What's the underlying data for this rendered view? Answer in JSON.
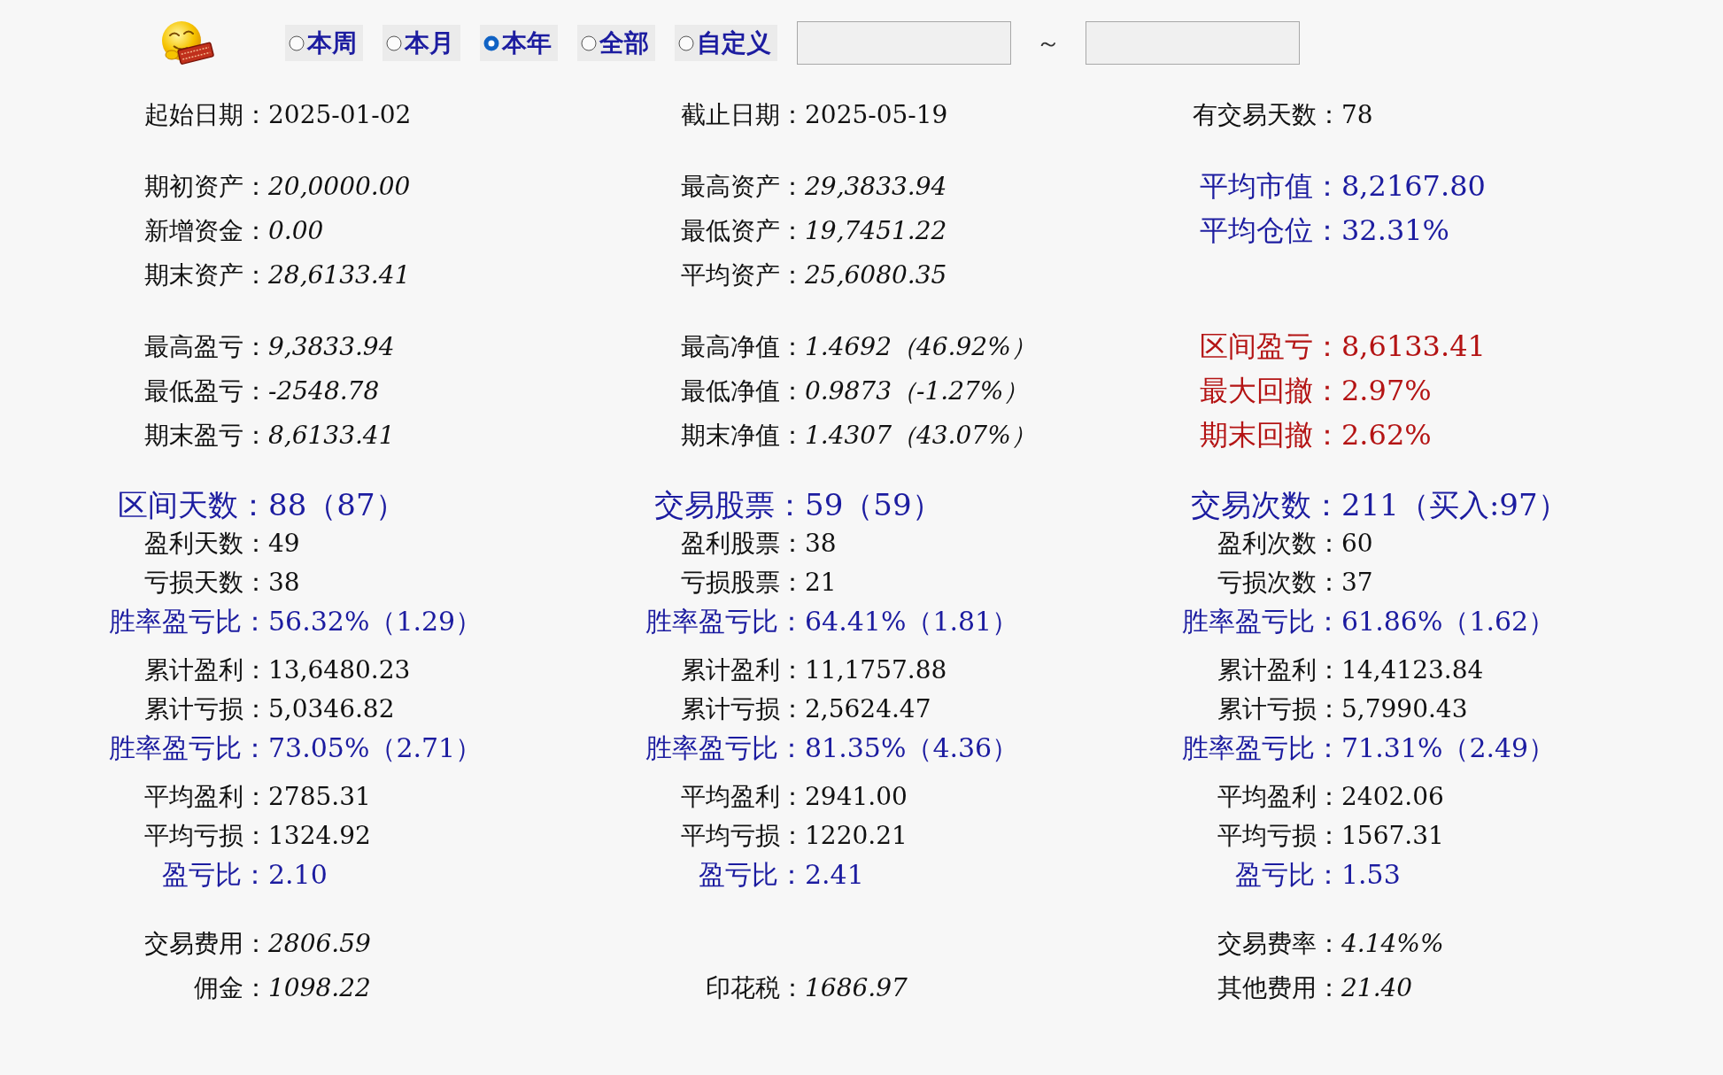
{
  "toolbar": {
    "period_options": [
      {
        "label": "本周",
        "selected": false
      },
      {
        "label": "本月",
        "selected": false
      },
      {
        "label": "本年",
        "selected": true
      },
      {
        "label": "全部",
        "selected": false
      },
      {
        "label": "自定义",
        "selected": false
      }
    ],
    "range_separator": "～"
  },
  "sections": [
    {
      "kind": "regular",
      "groups": [
        {
          "rows": [
            {
              "left": {
                "kind": "plain",
                "label": "起始日期：",
                "value": "2025-01-02"
              },
              "middle": {
                "kind": "plain",
                "label": "截止日期：",
                "value": "2025-05-19"
              },
              "right": {
                "kind": "plain",
                "label": "有交易天数：",
                "value": "78"
              }
            }
          ]
        }
      ]
    },
    {
      "kind": "regular",
      "groups": [
        {
          "rows": [
            {
              "left": {
                "kind": "italic",
                "label": "期初资产：",
                "value": "20,0000.00"
              },
              "middle": {
                "kind": "italic",
                "label": "最高资产：",
                "value": "29,3833.94"
              },
              "right": {
                "kind": "highlight",
                "label": "平均市值：",
                "value": "8,2167.80"
              }
            },
            {
              "left": {
                "kind": "italic",
                "label": "新增资金：",
                "value": "0.00"
              },
              "middle": {
                "kind": "italic",
                "label": "最低资产：",
                "value": "19,7451.22"
              },
              "right": {
                "kind": "highlight",
                "label": "平均仓位：",
                "value": "32.31%"
              }
            },
            {
              "left": {
                "kind": "italic",
                "label": "期末资产：",
                "value": "28,6133.41"
              },
              "middle": {
                "kind": "italic",
                "label": "平均资产：",
                "value": "25,6080.35"
              }
            }
          ]
        }
      ]
    },
    {
      "kind": "regular",
      "groups": [
        {
          "rows": [
            {
              "left": {
                "kind": "italic",
                "label": "最高盈亏：",
                "value": "9,3833.94"
              },
              "middle": {
                "kind": "italic",
                "label": "最高净值：",
                "value": "1.4692（46.92%）"
              },
              "right": {
                "kind": "alert",
                "label": "区间盈亏：",
                "value": "8,6133.41"
              }
            },
            {
              "left": {
                "kind": "italic",
                "label": "最低盈亏：",
                "value": "-2548.78"
              },
              "middle": {
                "kind": "italic",
                "label": "最低净值：",
                "value": "0.9873（-1.27%）"
              },
              "right": {
                "kind": "alert",
                "label": "最大回撤：",
                "value": "2.97%"
              }
            },
            {
              "left": {
                "kind": "italic",
                "label": "期末盈亏：",
                "value": "8,6133.41"
              },
              "middle": {
                "kind": "italic",
                "label": "期末净值：",
                "value": "1.4307（43.07%）"
              },
              "right": {
                "kind": "alert",
                "label": "期末回撤：",
                "value": "2.62%"
              }
            }
          ]
        }
      ]
    },
    {
      "kind": "compact",
      "groups": [
        {
          "rows": [
            {
              "left": {
                "kind": "heading",
                "label": "区间天数：",
                "value": "88（87）"
              },
              "middle": {
                "kind": "heading",
                "label": "交易股票：",
                "value": "59（59）"
              },
              "right": {
                "kind": "heading",
                "label": "交易次数：",
                "value": "211（买入:97）"
              }
            },
            {
              "left": {
                "kind": "plain",
                "label": "盈利天数：",
                "value": "49"
              },
              "middle": {
                "kind": "plain",
                "label": "盈利股票：",
                "value": "38"
              },
              "right": {
                "kind": "plain",
                "label": "盈利次数：",
                "value": "60"
              }
            },
            {
              "left": {
                "kind": "plain",
                "label": "亏损天数：",
                "value": "38"
              },
              "middle": {
                "kind": "plain",
                "label": "亏损股票：",
                "value": "21"
              },
              "right": {
                "kind": "plain",
                "label": "亏损次数：",
                "value": "37"
              }
            },
            {
              "left": {
                "kind": "ratio",
                "label": "胜率盈亏比：",
                "value": "56.32%（1.29）"
              },
              "middle": {
                "kind": "ratio",
                "label": "胜率盈亏比：",
                "value": "64.41%（1.81）"
              },
              "right": {
                "kind": "ratio",
                "label": "胜率盈亏比：",
                "value": "61.86%（1.62）"
              }
            }
          ]
        },
        {
          "rows": [
            {
              "left": {
                "kind": "plain",
                "label": "累计盈利：",
                "value": "13,6480.23"
              },
              "middle": {
                "kind": "plain",
                "label": "累计盈利：",
                "value": "11,1757.88"
              },
              "right": {
                "kind": "plain",
                "label": "累计盈利：",
                "value": "14,4123.84"
              }
            },
            {
              "left": {
                "kind": "plain",
                "label": "累计亏损：",
                "value": "5,0346.82"
              },
              "middle": {
                "kind": "plain",
                "label": "累计亏损：",
                "value": "2,5624.47"
              },
              "right": {
                "kind": "plain",
                "label": "累计亏损：",
                "value": "5,7990.43"
              }
            },
            {
              "left": {
                "kind": "ratio",
                "label": "胜率盈亏比：",
                "value": "73.05%（2.71）"
              },
              "middle": {
                "kind": "ratio",
                "label": "胜率盈亏比：",
                "value": "81.35%（4.36）"
              },
              "right": {
                "kind": "ratio",
                "label": "胜率盈亏比：",
                "value": "71.31%（2.49）"
              }
            }
          ]
        },
        {
          "rows": [
            {
              "left": {
                "kind": "plain",
                "label": "平均盈利：",
                "value": "2785.31"
              },
              "middle": {
                "kind": "plain",
                "label": "平均盈利：",
                "value": "2941.00"
              },
              "right": {
                "kind": "plain",
                "label": "平均盈利：",
                "value": "2402.06"
              }
            },
            {
              "left": {
                "kind": "plain",
                "label": "平均亏损：",
                "value": "1324.92"
              },
              "middle": {
                "kind": "plain",
                "label": "平均亏损：",
                "value": "1220.21"
              },
              "right": {
                "kind": "plain",
                "label": "平均亏损：",
                "value": "1567.31"
              }
            },
            {
              "left": {
                "kind": "ratio",
                "label": "盈亏比：",
                "value": "2.10"
              },
              "middle": {
                "kind": "ratio",
                "label": "盈亏比：",
                "value": "2.41"
              },
              "right": {
                "kind": "ratio",
                "label": "盈亏比：",
                "value": "1.53"
              }
            }
          ]
        }
      ]
    },
    {
      "kind": "regular",
      "groups": [
        {
          "rows": [
            {
              "left": {
                "kind": "italic",
                "label": "交易费用：",
                "value": "2806.59"
              },
              "right": {
                "kind": "italic",
                "label": "交易费率：",
                "value": "4.14%%"
              }
            },
            {
              "left": {
                "kind": "italic",
                "label": "佣金：",
                "value": "1098.22"
              },
              "middle": {
                "kind": "italic",
                "label": "印花税：",
                "value": "1686.97"
              },
              "right": {
                "kind": "italic",
                "label": "其他费用：",
                "value": "21.40"
              }
            }
          ]
        }
      ]
    }
  ]
}
